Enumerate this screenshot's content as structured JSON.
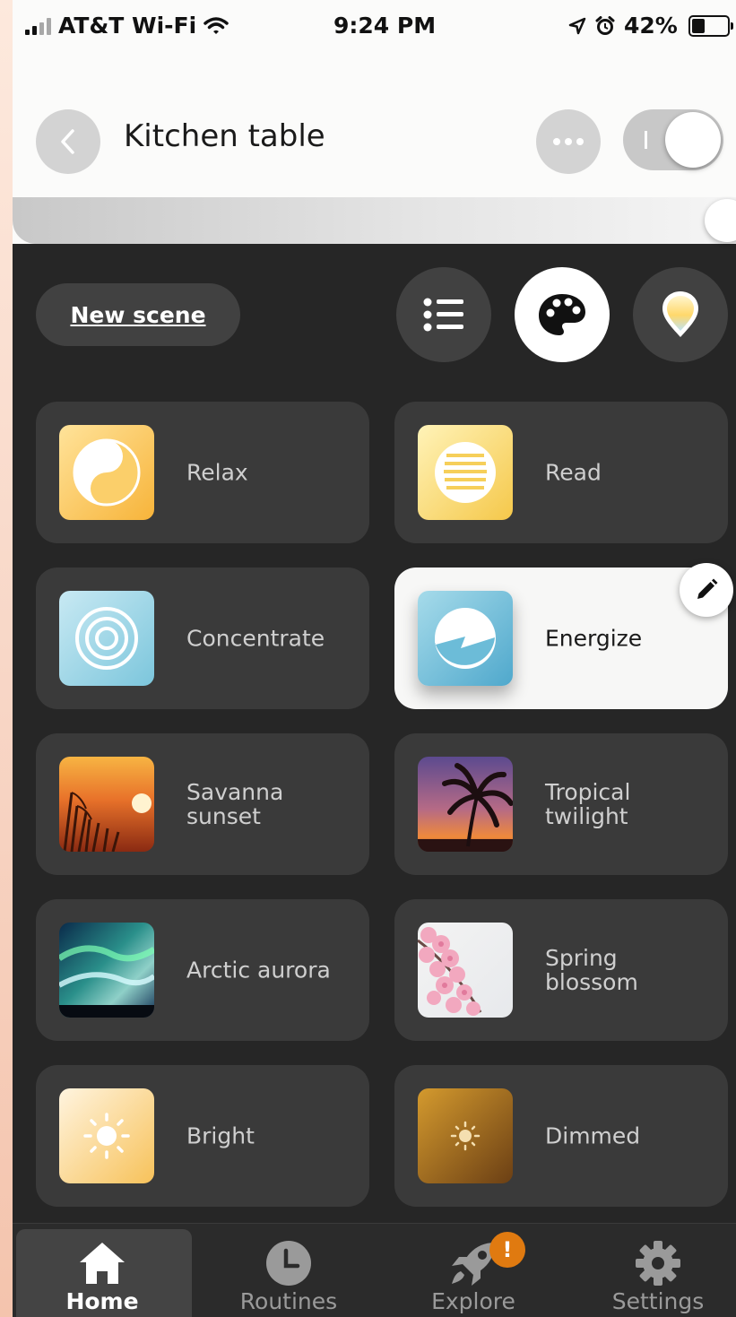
{
  "status_bar": {
    "carrier": "AT&T Wi-Fi",
    "time": "9:24 PM",
    "battery": "42%",
    "battery_level": 0.42,
    "icons": [
      "signal-icon",
      "wifi-icon",
      "location-arrow-icon",
      "alarm-icon",
      "battery-icon"
    ]
  },
  "header": {
    "title": "Kitchen table",
    "back_icon": "chevron-left-icon",
    "more_icon": "ellipsis-icon",
    "power_on": true,
    "brightness": 1.0
  },
  "controls": {
    "new_scene_label": "New scene",
    "view_modes": [
      {
        "icon": "list-icon",
        "active": false
      },
      {
        "icon": "palette-icon",
        "active": true
      },
      {
        "icon": "color-picker-pin-icon",
        "active": false
      }
    ]
  },
  "scenes": [
    {
      "label": "Relax",
      "icon": "yin-yang-icon",
      "selected": false
    },
    {
      "label": "Read",
      "icon": "lines-icon",
      "selected": false
    },
    {
      "label": "Concentrate",
      "icon": "concentric-circles-icon",
      "selected": false
    },
    {
      "label": "Energize",
      "icon": "energy-circle-icon",
      "selected": true
    },
    {
      "label": "Savanna sunset",
      "icon": "savanna-sunset-photo",
      "selected": false
    },
    {
      "label": "Tropical twilight",
      "icon": "palm-tree-photo",
      "selected": false
    },
    {
      "label": "Arctic aurora",
      "icon": "aurora-photo",
      "selected": false
    },
    {
      "label": "Spring blossom",
      "icon": "blossom-photo",
      "selected": false
    },
    {
      "label": "Bright",
      "icon": "sun-icon",
      "selected": false
    },
    {
      "label": "Dimmed",
      "icon": "dim-sun-icon",
      "selected": false
    }
  ],
  "edit_icon": "pencil-icon",
  "tabs": [
    {
      "label": "Home",
      "icon": "home-icon",
      "active": true
    },
    {
      "label": "Routines",
      "icon": "clock-icon",
      "active": false
    },
    {
      "label": "Explore",
      "icon": "rocket-icon",
      "active": false,
      "badge": "!"
    },
    {
      "label": "Settings",
      "icon": "gear-icon",
      "active": false
    }
  ],
  "colors": {
    "background": "#262626",
    "card": "#3a3a3a",
    "selected_card": "#f7f7f6",
    "badge": "#e07a10"
  }
}
